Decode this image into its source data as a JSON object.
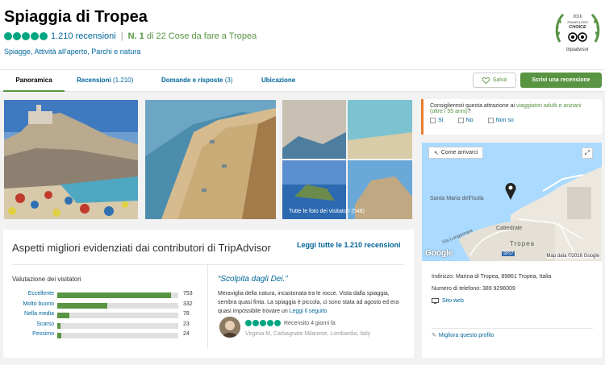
{
  "header": {
    "title": "Spiaggia di Tropea",
    "reviews_count": "1.210 recensioni",
    "rank_prefix": "N. 1",
    "rank_suffix": "di 22 Cose da fare a Tropea",
    "categories": "Spiagge, Attività all'aperto, Parchi e natura",
    "rating_bubbles": 5,
    "badge": {
      "year": "2016",
      "line1": "TRAVELLERS'",
      "line2": "CHOICE",
      "brand": "tripadvisor"
    }
  },
  "tabs": [
    {
      "label": "Panoramica",
      "count": ""
    },
    {
      "label": "Recensioni",
      "count": "(1.210)"
    },
    {
      "label": "Domande e risposte",
      "count": "(3)"
    },
    {
      "label": "Ubicazione",
      "count": ""
    }
  ],
  "actions": {
    "save": "Salva",
    "write_review": "Scrivi una recensione"
  },
  "photos": {
    "all_label": "Tutte le foto dei visitatori (548)"
  },
  "ask": {
    "question_prefix": "Consiglieresti questa attrazione ai",
    "question_highlight": "viaggiatori adulti e anziani (oltre i 55 anni)",
    "question_suffix": "?",
    "options": [
      "Sì",
      "No",
      "Non so"
    ]
  },
  "map": {
    "directions_button": "Come arrivarci",
    "labels": [
      "Santa Maria dell'Isola",
      "Cattedrale",
      "Tropea",
      "Via Lungomare",
      "SP17"
    ],
    "logo": "Google",
    "copyright": "Map data ©2016 Google"
  },
  "info": {
    "address": "Indirizzo: Marina di Tropea, 89861 Tropea, Italia",
    "phone": "Numero di telefono: 389 9296009",
    "website": "Sito web",
    "improve": "Migliora questo profilo"
  },
  "highlights": {
    "title": "Aspetti migliori evidenziati dai contributori di TripAdvisor",
    "read_all": "Leggi tutte le 1.210 recensioni"
  },
  "visitor_rating": {
    "title": "Valutazione dei visitatori",
    "max": 800,
    "rows": [
      {
        "label": "Eccellente",
        "count": 753
      },
      {
        "label": "Molto buono",
        "count": 332
      },
      {
        "label": "Nella media",
        "count": 78
      },
      {
        "label": "Scarso",
        "count": 23
      },
      {
        "label": "Pessimo",
        "count": 24
      }
    ]
  },
  "review": {
    "title": "“Scolpita dagli Dei.”",
    "text": "Meraviglia della natura, incastonata tra le rocce. Vista dalla spiaggia, sembra quasi finta. La spiaggia è piccola, ci sono stata ad agosto ed era quasi impossibile trovare un",
    "more": "Leggi il seguito",
    "date": "Recensito 4 giorni fa",
    "user": "Virginia M, Carbagnate Milanese, Lombardia, Italy",
    "bubbles": 5
  },
  "colors": {
    "brand_green": "#589442",
    "link": "#006699",
    "bubble": "#00a680",
    "accent": "#e77d2d"
  }
}
